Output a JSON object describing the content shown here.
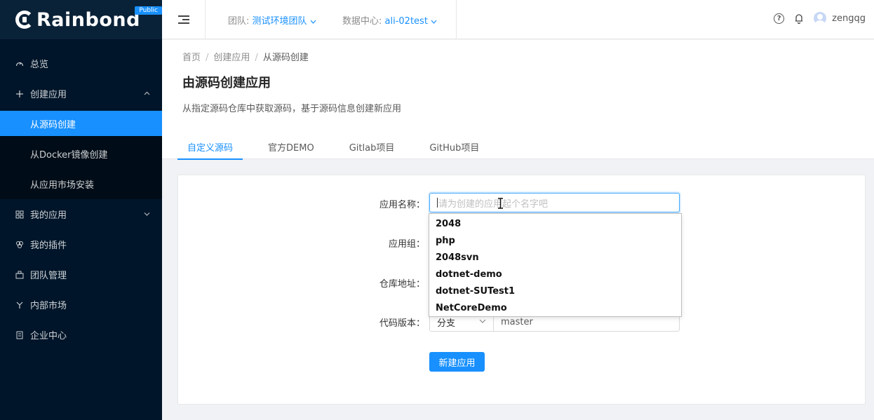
{
  "brand": {
    "name": "Rainbond",
    "badge": "Public"
  },
  "header": {
    "team_label": "团队:",
    "team_value": "测试环境团队",
    "dc_label": "数据中心:",
    "dc_value": "ali-02test",
    "username": "zengqg"
  },
  "sidebar": {
    "items": [
      {
        "label": "总览",
        "icon": "dashboard-icon"
      },
      {
        "label": "创建应用",
        "icon": "plus-icon",
        "expanded": true,
        "children": [
          {
            "label": "从源码创建",
            "active": true
          },
          {
            "label": "从Docker镜像创建"
          },
          {
            "label": "从应用市场安装"
          }
        ]
      },
      {
        "label": "我的应用",
        "icon": "appstore-icon"
      },
      {
        "label": "我的插件",
        "icon": "plugin-icon"
      },
      {
        "label": "团队管理",
        "icon": "team-icon"
      },
      {
        "label": "内部市场",
        "icon": "fork-icon"
      },
      {
        "label": "企业中心",
        "icon": "building-icon"
      }
    ]
  },
  "breadcrumb": [
    "首页",
    "创建应用",
    "从源码创建"
  ],
  "page": {
    "title": "由源码创建应用",
    "description": "从指定源码仓库中获取源码，基于源码信息创建新应用"
  },
  "tabs": [
    "自定义源码",
    "官方DEMO",
    "Gitlab项目",
    "GitHub项目"
  ],
  "form": {
    "app_name_label": "应用名称",
    "app_name_placeholder": "请为创建的应用起个名字吧",
    "app_group_label": "应用组",
    "repo_label": "仓库地址",
    "code_version_label": "代码版本",
    "version_type": "分支",
    "version_value": "master",
    "submit_label": "新建应用"
  },
  "autocomplete": [
    "2048",
    "php",
    "2048svn",
    "dotnet-demo",
    "dotnet-SUTest1",
    "NetCoreDemo"
  ],
  "colors": {
    "primary": "#1890ff",
    "sidebar_bg": "#001529"
  }
}
